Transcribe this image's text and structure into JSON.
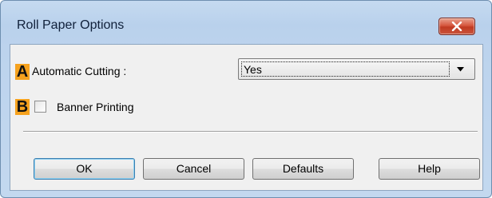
{
  "window": {
    "title": "Roll Paper Options"
  },
  "options": {
    "automatic_cutting": {
      "badge": "A",
      "label": "Automatic Cutting :",
      "selected_value": "Yes"
    },
    "banner_printing": {
      "badge": "B",
      "label": "Banner Printing",
      "checked": false
    }
  },
  "buttons": {
    "ok": "OK",
    "cancel": "Cancel",
    "defaults": "Defaults",
    "help": "Help"
  },
  "colors": {
    "badge": "#f6a21e",
    "close_button": "#c9563c",
    "title_bar": "#bcd3ed"
  }
}
